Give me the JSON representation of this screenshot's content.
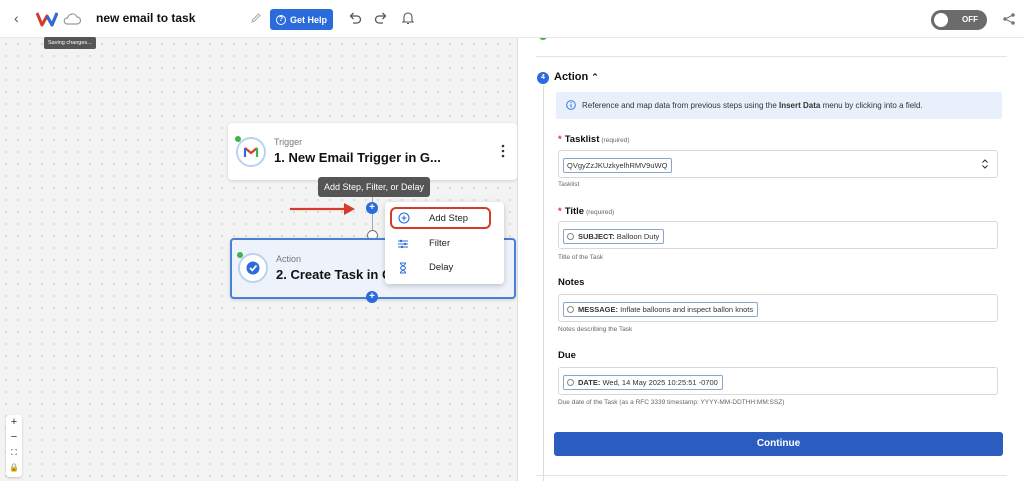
{
  "header": {
    "workflow_title": "new email to task",
    "help_label": "Get Help",
    "saving_tooltip": "Saving changes...",
    "toggle_label": "OFF",
    "brand_color": "#2b6bdb"
  },
  "canvas": {
    "trigger_node": {
      "kind": "Trigger",
      "title": "1. New Email Trigger in G..."
    },
    "action_node": {
      "kind": "Action",
      "title": "2. Create Task in G"
    },
    "add_tooltip": "Add Step, Filter, or Delay",
    "menu": [
      {
        "label": "Add Step",
        "icon": "add-step-icon"
      },
      {
        "label": "Filter",
        "icon": "filter-icon"
      },
      {
        "label": "Delay",
        "icon": "delay-icon"
      }
    ],
    "zoom": [
      "+",
      "−",
      "⛶",
      "🔒"
    ]
  },
  "panel": {
    "step_number": "4",
    "step_title": "Action",
    "info_text_1": "Reference and map data from previous steps using the ",
    "info_text_bold": "Insert Data",
    "info_text_2": " menu by clicking into a field.",
    "required_label": "(required)",
    "tasklist": {
      "label": "Tasklist",
      "value": "QVgyZzJKUzkyelhRMV9uWQ",
      "hint": "Tasklist"
    },
    "title": {
      "label": "Title",
      "pill_key": "SUBJECT:",
      "pill_value": "Balloon Duty",
      "hint": "Title of the Task"
    },
    "notes": {
      "label": "Notes",
      "pill_key": "MESSAGE:",
      "pill_value": "Inflate balloons and inspect ballon knots",
      "hint": "Notes describing the Task"
    },
    "due": {
      "label": "Due",
      "pill_key": "DATE:",
      "pill_value": "Wed, 14 May 2025 10:25:51 -0700",
      "hint": "Due date of the Task (as a RFC 3339 timestamp: YYYY-MM-DDTHH:MM:SSZ)"
    },
    "continue_label": "Continue"
  }
}
